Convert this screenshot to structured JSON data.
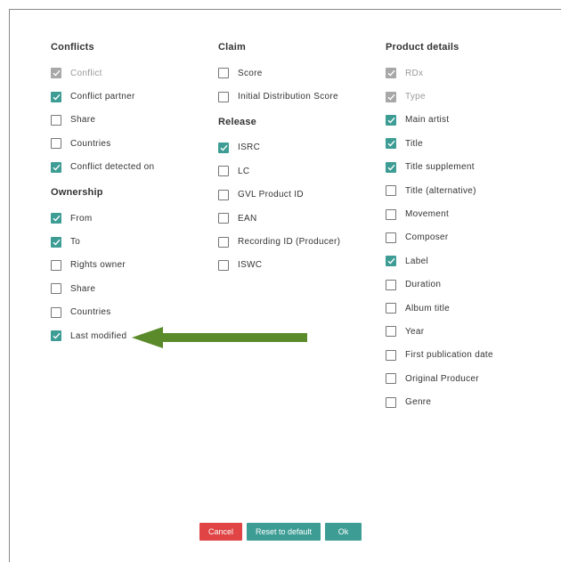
{
  "columns": [
    {
      "groups": [
        {
          "title": "Conflicts",
          "items": [
            {
              "label": "Conflict",
              "checked": true,
              "disabled": true
            },
            {
              "label": "Conflict partner",
              "checked": true
            },
            {
              "label": "Share",
              "checked": false
            },
            {
              "label": "Countries",
              "checked": false
            },
            {
              "label": "Conflict detected on",
              "checked": true
            }
          ]
        },
        {
          "title": "Ownership",
          "items": [
            {
              "label": "From",
              "checked": true
            },
            {
              "label": "To",
              "checked": true
            },
            {
              "label": "Rights owner",
              "checked": false
            },
            {
              "label": "Share",
              "checked": false
            },
            {
              "label": "Countries",
              "checked": false
            },
            {
              "label": "Last modified",
              "checked": true
            }
          ]
        }
      ]
    },
    {
      "groups": [
        {
          "title": "Claim",
          "items": [
            {
              "label": "Score",
              "checked": false
            },
            {
              "label": "Initial Distribution Score",
              "checked": false
            }
          ]
        },
        {
          "title": "Release",
          "items": [
            {
              "label": "ISRC",
              "checked": true
            },
            {
              "label": "LC",
              "checked": false
            },
            {
              "label": "GVL Product ID",
              "checked": false
            },
            {
              "label": "EAN",
              "checked": false
            },
            {
              "label": "Recording ID (Producer)",
              "checked": false
            },
            {
              "label": "ISWC",
              "checked": false
            }
          ]
        }
      ]
    },
    {
      "groups": [
        {
          "title": "Product details",
          "items": [
            {
              "label": "RDx",
              "checked": true,
              "disabled": true
            },
            {
              "label": "Type",
              "checked": true,
              "disabled": true
            },
            {
              "label": "Main artist",
              "checked": true
            },
            {
              "label": "Title",
              "checked": true
            },
            {
              "label": "Title supplement",
              "checked": true
            },
            {
              "label": "Title (alternative)",
              "checked": false
            },
            {
              "label": "Movement",
              "checked": false
            },
            {
              "label": "Composer",
              "checked": false
            },
            {
              "label": "Label",
              "checked": true
            },
            {
              "label": "Duration",
              "checked": false
            },
            {
              "label": "Album title",
              "checked": false
            },
            {
              "label": "Year",
              "checked": false
            },
            {
              "label": "First publication date",
              "checked": false
            },
            {
              "label": "Original Producer",
              "checked": false
            },
            {
              "label": "Genre",
              "checked": false
            }
          ]
        }
      ]
    }
  ],
  "footer": {
    "cancel_label": "Cancel",
    "reset_label": "Reset to default",
    "ok_label": "Ok"
  },
  "colors": {
    "accent": "#3d9d95",
    "danger": "#e04444",
    "annotation_arrow": "#5b8a2a"
  },
  "icons": {
    "checkmark": "check-icon",
    "annotation": "arrow-left-icon"
  }
}
